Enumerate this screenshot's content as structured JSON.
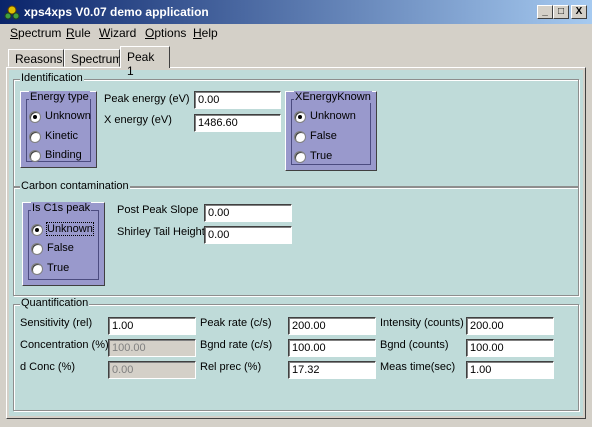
{
  "window": {
    "title": "xps4xps V0.07 demo application",
    "controls": {
      "minimize": "_",
      "maximize": "□",
      "close": "X"
    }
  },
  "menu": [
    {
      "label": "Spectrum",
      "accel_index": 0
    },
    {
      "label": "Rule",
      "accel_index": 0
    },
    {
      "label": "Wizard",
      "accel_index": 0
    },
    {
      "label": "Options",
      "accel_index": 0
    },
    {
      "label": "Help",
      "accel_index": 0
    }
  ],
  "tabs": [
    {
      "label": "Reasons",
      "active": false
    },
    {
      "label": "Spectrum",
      "active": false
    },
    {
      "label": "Peak 1",
      "active": true
    }
  ],
  "identification": {
    "label": "Identification",
    "energy_type": {
      "title": "Energy type",
      "options": [
        "Unknown",
        "Kinetic",
        "Binding"
      ],
      "selected": "Unknown"
    },
    "peak_energy": {
      "label": "Peak energy (eV)",
      "value": "0.00"
    },
    "x_energy": {
      "label": "X energy (eV)",
      "value": "1486.60"
    },
    "xenergy_known": {
      "title": "XEnergyKnown",
      "options": [
        "Unknown",
        "False",
        "True"
      ],
      "selected": "Unknown"
    }
  },
  "carbon": {
    "label": "Carbon contamination",
    "is_c1s": {
      "title": "Is C1s peak",
      "options": [
        "Unknown",
        "False",
        "True"
      ],
      "selected": "Unknown"
    },
    "post_peak_slope": {
      "label": "Post Peak Slope",
      "value": "0.00"
    },
    "shirley_tail_height": {
      "label": "Shirley Tail Height",
      "value": "0.00"
    }
  },
  "quantification": {
    "label": "Quantification",
    "sensitivity": {
      "label": "Sensitivity (rel)",
      "value": "1.00"
    },
    "concentration": {
      "label": "Concentration (%)",
      "value": "100.00"
    },
    "d_conc": {
      "label": "d Conc (%)",
      "value": "0.00"
    },
    "peak_rate": {
      "label": "Peak rate (c/s)",
      "value": "200.00"
    },
    "bgnd_rate": {
      "label": "Bgnd rate (c/s)",
      "value": "100.00"
    },
    "rel_prec": {
      "label": "Rel prec (%)",
      "value": "17.32"
    },
    "intensity": {
      "label": "Intensity (counts)",
      "value": "200.00"
    },
    "bgnd_counts": {
      "label": "Bgnd (counts)",
      "value": "100.00"
    },
    "meas_time": {
      "label": "Meas time(sec)",
      "value": "1.00"
    }
  },
  "colors": {
    "titlebar_start": "#0a246a",
    "titlebar_end": "#a6caf0",
    "panel_bg": "#bfdbd9",
    "radio_box_bg": "#9999cc",
    "window_bg": "#d4d0c8"
  }
}
